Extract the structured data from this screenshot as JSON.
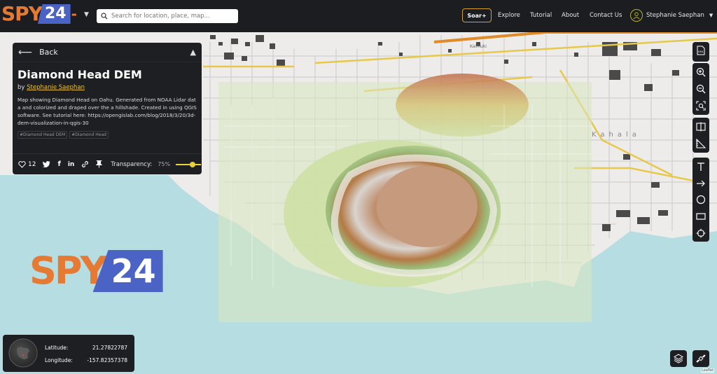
{
  "header": {
    "logo_text": "SPY",
    "logo_number": "24",
    "search_placeholder": "Search for location, place, map...",
    "soar_button": "Soar+",
    "nav": [
      "Explore",
      "Tutorial",
      "About",
      "Contact Us"
    ],
    "user_name": "Stephanie Saephan"
  },
  "panel": {
    "back_label": "Back",
    "title": "Diamond Head DEM",
    "by_prefix": "by",
    "author": "Stephanie Saephan",
    "description": "Map showing Diamond Head on Oahu. Generated from NOAA Lidar data and colorized and draped over the a hillshade. Created in using QGIS software. See tutorial here: https://opengislab.com/blog/2018/3/20/3d-dem-visualization-in-qgis-30",
    "tags": [
      "#Diamond Head DEM",
      "#Diamond Head"
    ],
    "likes": "12",
    "transparency_label": "Transparency:",
    "transparency_value": "75%",
    "transparency_level": 0.75
  },
  "map": {
    "labels": [
      "Kaimuki",
      "Kahala"
    ]
  },
  "watermark": {
    "text": "SPY",
    "number": "24"
  },
  "toolbar": {
    "tools": [
      "kml-upload",
      "zoom-in",
      "zoom-out",
      "zoom-to-extent",
      "compare",
      "measure",
      "text",
      "arrow",
      "circle",
      "rectangle",
      "crosshair"
    ],
    "kml_label": "KML"
  },
  "coordinates": {
    "latitude_label": "Latitude:",
    "latitude_value": "21.27822787",
    "longitude_label": "Longitude:",
    "longitude_value": "-157.82357378"
  },
  "attribution": "Leaflet",
  "colors": {
    "accent_gold": "#d6a12a",
    "link_yellow": "#e8c03c",
    "brand_orange": "#e57a34",
    "brand_blue": "#4b63c4",
    "panel_bg": "#1e1f23"
  }
}
